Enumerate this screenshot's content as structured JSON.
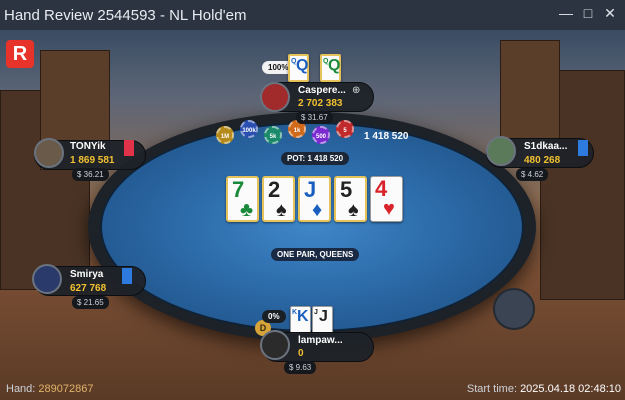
{
  "window": {
    "title": "Hand Review 2544593 - NL Hold'em",
    "min_icon": "minimize-icon",
    "max_icon": "maximize-icon",
    "close_icon": "close-icon"
  },
  "logo": {
    "letter": "R"
  },
  "board": {
    "cards": [
      {
        "rank": "7",
        "suit": "♣",
        "color": "green"
      },
      {
        "rank": "2",
        "suit": "♠",
        "color": "black"
      },
      {
        "rank": "J",
        "suit": "♦",
        "color": "blue"
      },
      {
        "rank": "5",
        "suit": "♠",
        "color": "black"
      },
      {
        "rank": "4",
        "suit": "♥",
        "color": "red"
      }
    ]
  },
  "pot": {
    "label": "POT: 1 418 520",
    "side_total": "1 418 520"
  },
  "hand_result": "ONE PAIR, QUEENS",
  "chips": [
    "1M",
    "100k",
    "5k",
    "1k",
    "500",
    "5"
  ],
  "players": {
    "top": {
      "name": "Caspere...",
      "stack": "2 702 383",
      "bounty": "$ 31.67",
      "equity": "100%",
      "cards": [
        {
          "rank": "Q",
          "color": "blue"
        },
        {
          "rank": "Q",
          "color": "green"
        }
      ]
    },
    "left_top": {
      "name": "TONYik",
      "stack": "1 869 581",
      "bounty": "$ 36.21"
    },
    "right": {
      "name": "S1dkaa...",
      "stack": "480 268",
      "bounty": "$ 4.62"
    },
    "left_bottom": {
      "name": "Smirya",
      "stack": "627 768",
      "bounty": "$ 21.65"
    },
    "bottom": {
      "name": "lampaw...",
      "stack": "0",
      "bounty": "$ 9.63",
      "equity": "0%",
      "cards": [
        {
          "rank": "K",
          "color": "blue"
        },
        {
          "rank": "J",
          "color": "black"
        }
      ]
    }
  },
  "dealer_label": "D",
  "footer": {
    "hand_label": "Hand:",
    "hand_id": "289072867",
    "start_label": "Start time:",
    "start_time": "2025.04.18 02:48:10"
  }
}
